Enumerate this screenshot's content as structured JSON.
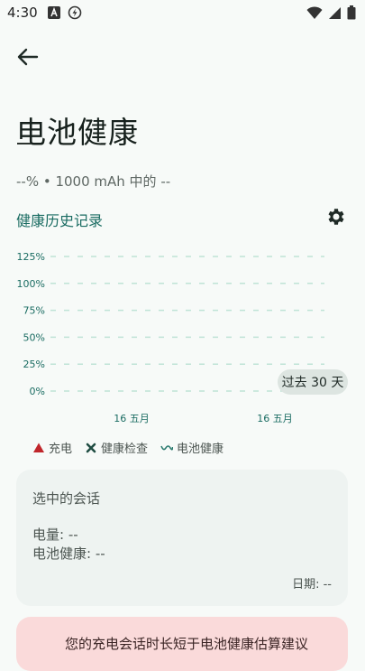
{
  "status_bar": {
    "time": "4:30"
  },
  "page": {
    "title": "电池健康",
    "subtitle": "--% • 1000 mAh 中的 --"
  },
  "history": {
    "section_title": "健康历史记录",
    "range_label": "过去 30 天"
  },
  "chart_data": {
    "type": "scatter",
    "ylabel": "",
    "xlabel": "",
    "y_ticks": [
      "125%",
      "100%",
      "75%",
      "50%",
      "25%",
      "0%"
    ],
    "ylim": [
      0,
      125
    ],
    "x_ticks": [
      "16 五月",
      "16 五月"
    ],
    "series": [],
    "grid": "dashed horizontal",
    "grid_color": "#bfe3d6",
    "legend": [
      "充电",
      "健康检查",
      "电池健康"
    ]
  },
  "legend": {
    "charge": "充电",
    "health_check": "健康检查",
    "battery_health": "电池健康",
    "colors": {
      "charge": "#c0262b",
      "health_check": "#1f4d42",
      "battery_health": "#2a7a6e"
    }
  },
  "selected_session": {
    "title": "选中的会话",
    "charge_line": "电量: --",
    "health_line": "电池健康: --",
    "date_line": "日期: --"
  },
  "warning": {
    "text": "您的充电会话时长短于电池健康估算建议"
  }
}
